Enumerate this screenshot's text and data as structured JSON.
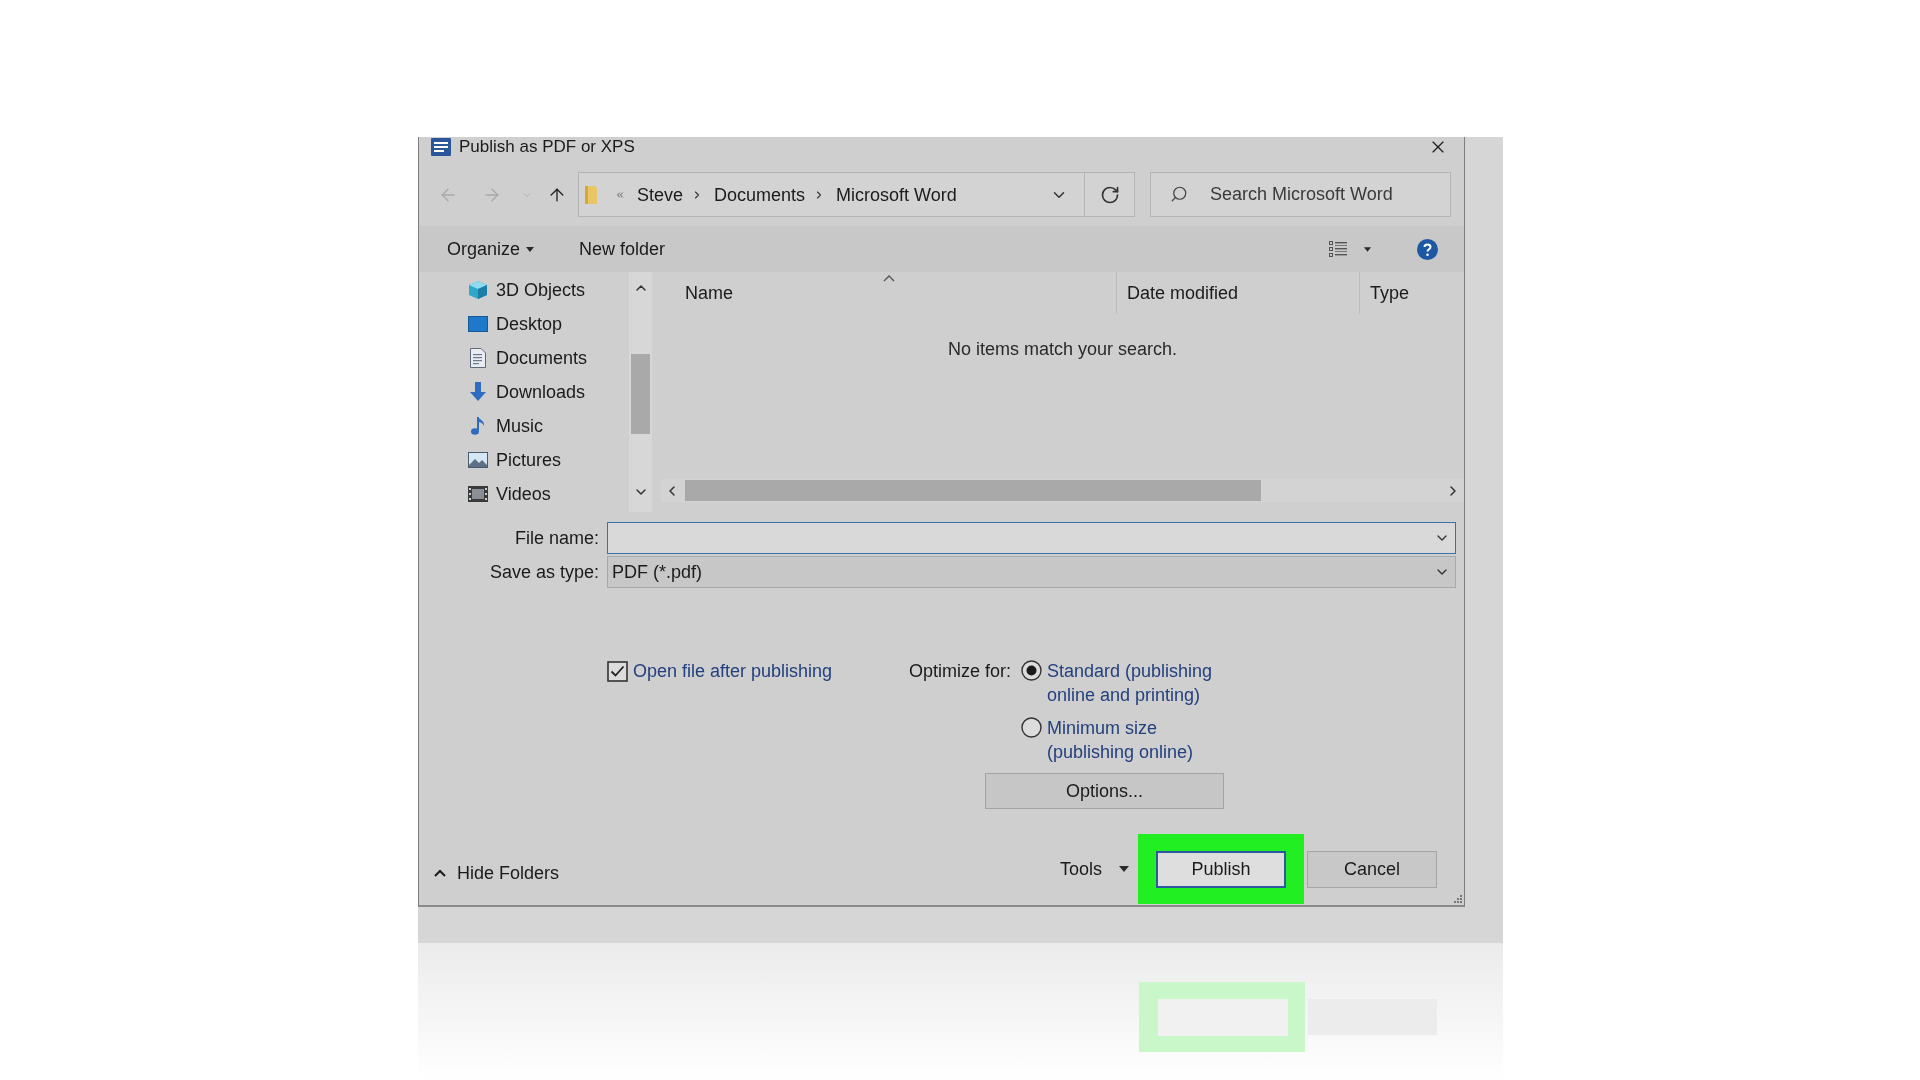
{
  "window": {
    "title": "Publish as PDF or XPS"
  },
  "navigation": {
    "buttons": [
      {
        "kind": "back",
        "disabled": true
      },
      {
        "kind": "forward",
        "disabled": true
      },
      {
        "kind": "recent",
        "disabled": true
      },
      {
        "kind": "up",
        "disabled": false
      }
    ],
    "path": [
      "Steve",
      "Documents",
      "Microsoft Word"
    ],
    "search": {
      "placeholder": "Search Microsoft Word"
    }
  },
  "toolbar": {
    "items": [
      {
        "label": "Organize",
        "kind": "menu"
      },
      {
        "label": "New folder",
        "kind": "button"
      }
    ]
  },
  "sidebar": {
    "items": [
      {
        "label": "3D Objects",
        "kind": "objects",
        "selected": false
      },
      {
        "label": "Desktop",
        "kind": "desktop",
        "selected": false
      },
      {
        "label": "Documents",
        "kind": "documents",
        "selected": false
      },
      {
        "label": "Downloads",
        "kind": "downloads",
        "selected": false
      },
      {
        "label": "Music",
        "kind": "music",
        "selected": false
      },
      {
        "label": "Pictures",
        "kind": "pictures",
        "selected": false
      },
      {
        "label": "Videos",
        "kind": "videos",
        "selected": false
      }
    ]
  },
  "file_list": {
    "columns": [
      {
        "label": "Name",
        "sorted": true
      },
      {
        "label": "Date modified",
        "sorted": false
      },
      {
        "label": "Type",
        "sorted": false
      }
    ],
    "empty_message": "No items match your search."
  },
  "fields": [
    {
      "label": "File name:",
      "kind": "combo",
      "focused": true
    },
    {
      "label": "Save as type:",
      "kind": "select",
      "value": "PDF (*.pdf)",
      "focused": false
    }
  ],
  "publish_options": {
    "open_after": {
      "label": "Open file after publishing",
      "checked": true
    },
    "optimize_label": "Optimize for:",
    "optimize_choices": [
      {
        "label": "Standard (publishing\nonline and printing)",
        "selected": true
      },
      {
        "label": "Minimum size\n(publishing online)",
        "selected": false
      }
    ],
    "options_button": "Options..."
  },
  "footer": {
    "hide_folders": "Hide Folders",
    "tools": "Tools",
    "buttons": [
      {
        "label": "Publish",
        "default": true,
        "highlighted": true
      },
      {
        "label": "Cancel",
        "default": false,
        "highlighted": false
      }
    ]
  }
}
